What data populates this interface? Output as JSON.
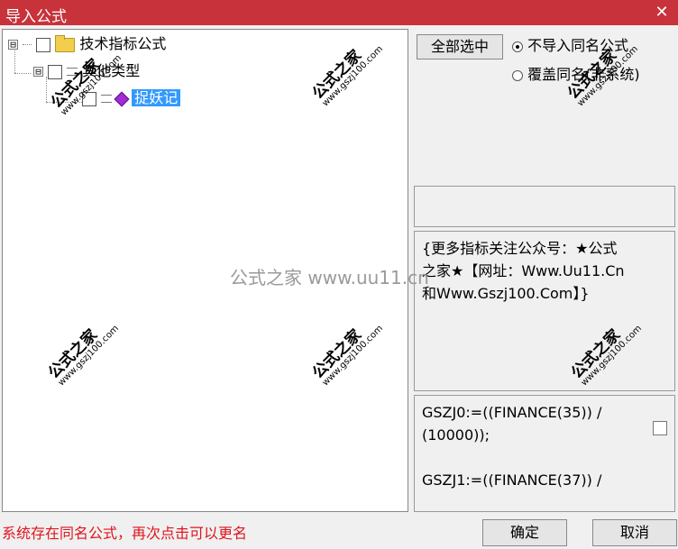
{
  "window": {
    "title": "导入公式",
    "close_glyph": "✕"
  },
  "tree": {
    "root": {
      "expander": "⊟",
      "label": "技术指标公式"
    },
    "child": {
      "expander": "⊟",
      "label": "其他类型"
    },
    "leaf": {
      "label": "捉妖记"
    }
  },
  "right": {
    "select_all": "全部选中",
    "radio_no_import": "不导入同名公式",
    "radio_overwrite": "覆盖同名(非系统)",
    "description_lines": [
      "{更多指标关注公众号：★公式",
      "之家★【网址：Www.Uu11.Cn",
      "和Www.Gszj100.Com】}"
    ],
    "code_lines": [
      "GSZJ0:=((FINANCE(35)) /",
      "(10000));",
      "",
      "GSZJ1:=((FINANCE(37)) /"
    ]
  },
  "status_text": "系统存在同名公式，再次点击可以更名",
  "buttons": {
    "ok": "确定",
    "cancel": "取消"
  },
  "watermark": {
    "line1": "公式之家",
    "line2": "www.gszj100.com",
    "center": "公式之家 www.uu11.cn"
  }
}
